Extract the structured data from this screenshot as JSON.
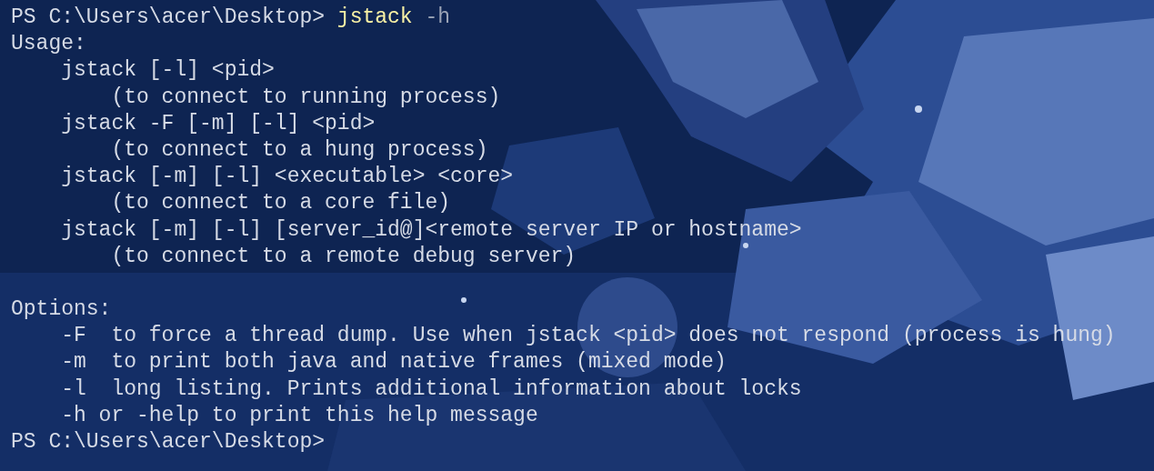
{
  "lines": [
    {
      "kind": "prompt",
      "prompt": "PS C:\\Users\\acer\\Desktop>",
      "command": "jstack",
      "args": "-h"
    },
    {
      "kind": "heading",
      "text": "Usage:"
    },
    {
      "kind": "usage",
      "text": "jstack [-l] <pid>"
    },
    {
      "kind": "note",
      "text": "(to connect to running process)"
    },
    {
      "kind": "usage",
      "text": "jstack -F [-m] [-l] <pid>"
    },
    {
      "kind": "note",
      "text": "(to connect to a hung process)"
    },
    {
      "kind": "usage",
      "text": "jstack [-m] [-l] <executable> <core>"
    },
    {
      "kind": "note",
      "text": "(to connect to a core file)"
    },
    {
      "kind": "usage",
      "text": "jstack [-m] [-l] [server_id@]<remote server IP or hostname>"
    },
    {
      "kind": "note",
      "text": "(to connect to a remote debug server)"
    },
    {
      "kind": "blank"
    },
    {
      "kind": "heading",
      "text": "Options:"
    },
    {
      "kind": "usage",
      "text": "-F  to force a thread dump. Use when jstack <pid> does not respond (process is hung)"
    },
    {
      "kind": "usage",
      "text": "-m  to print both java and native frames (mixed mode)"
    },
    {
      "kind": "usage",
      "text": "-l  long listing. Prints additional information about locks"
    },
    {
      "kind": "usage",
      "text": "-h or -help to print this help message"
    },
    {
      "kind": "prompt",
      "prompt": "PS C:\\Users\\acer\\Desktop>"
    }
  ]
}
